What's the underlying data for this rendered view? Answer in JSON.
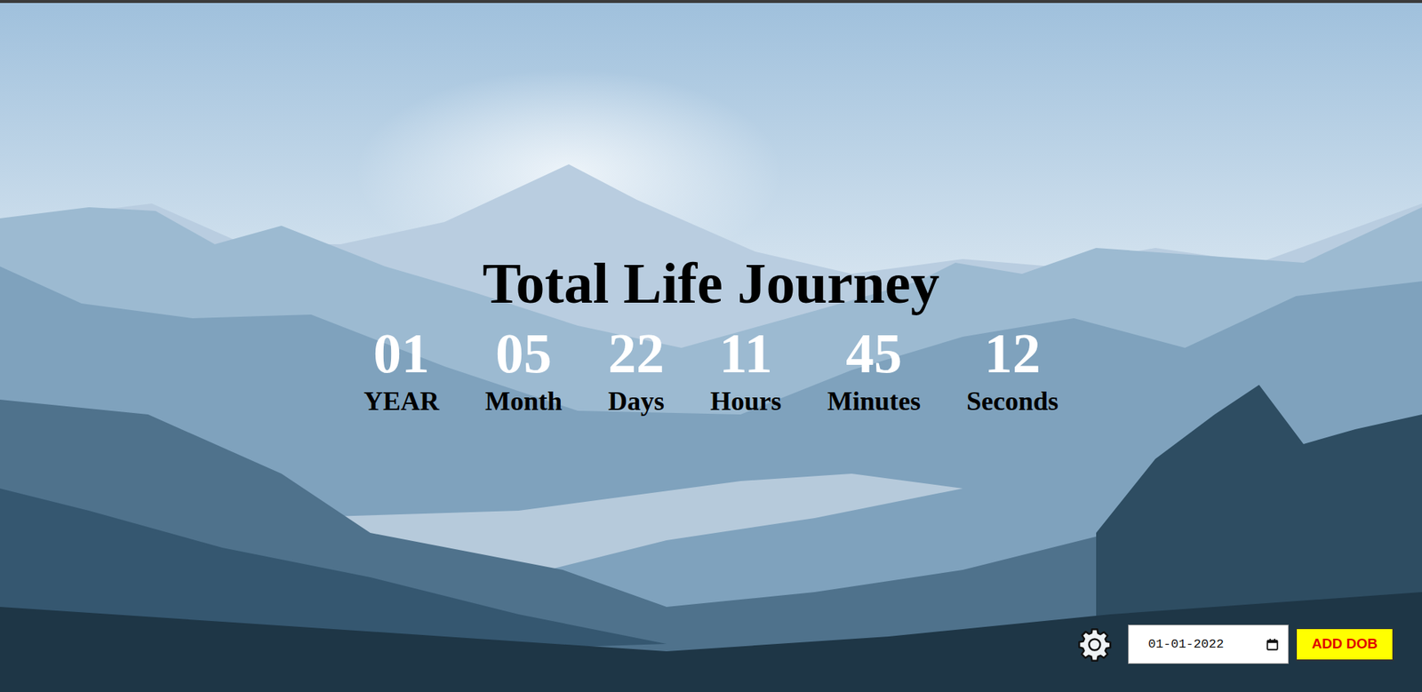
{
  "title": "Total Life Journey",
  "counters": [
    {
      "value": "01",
      "label": "YEAR"
    },
    {
      "value": "05",
      "label": "Month"
    },
    {
      "value": "22",
      "label": "Days"
    },
    {
      "value": "11",
      "label": "Hours"
    },
    {
      "value": "45",
      "label": "Minutes"
    },
    {
      "value": "12",
      "label": "Seconds"
    }
  ],
  "dob": {
    "value": "01-01-2022"
  },
  "add_button": "ADD DOB"
}
